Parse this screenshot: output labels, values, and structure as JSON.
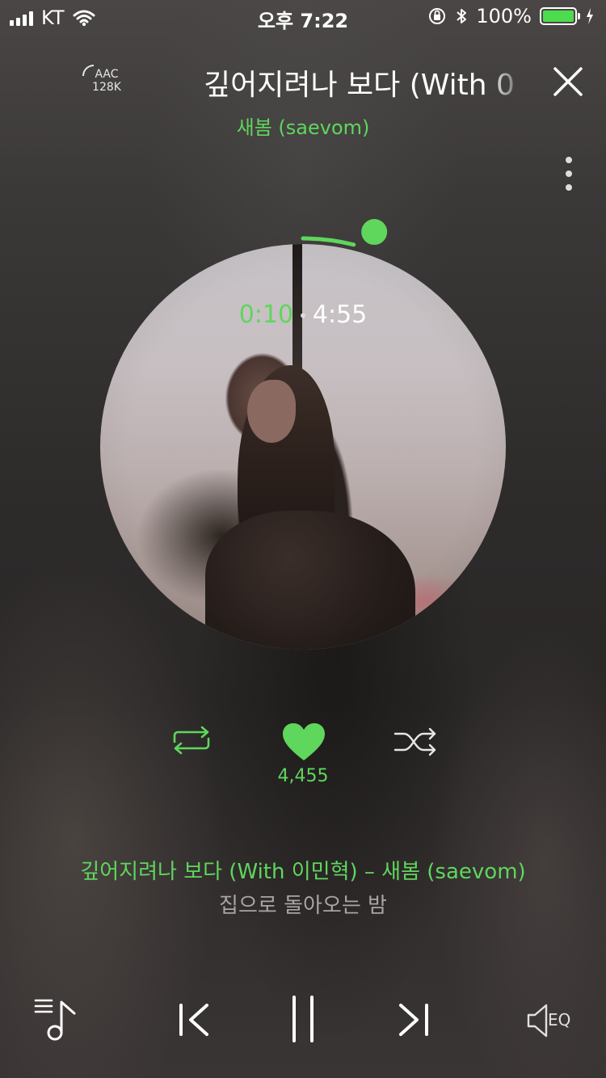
{
  "status_bar": {
    "carrier": "KT",
    "time": "오후 7:22",
    "battery_percent": "100%",
    "battery_level": 1.0,
    "icons": [
      "signal-icon",
      "wifi-icon",
      "orientation-lock-icon",
      "bluetooth-icon",
      "battery-icon",
      "charging-icon"
    ]
  },
  "header": {
    "codec_line1": "AAC",
    "codec_line2": "128K",
    "title": "깊어지려나 보다 (With 0",
    "close_icon": "close-icon",
    "artist": "새봄 (saevom)",
    "more_icon": "more-vertical-icon"
  },
  "player": {
    "current_time": "0:10",
    "separator": "•",
    "total_time": "4:55",
    "progress_fraction": 0.034,
    "accent_color": "#5fd65c"
  },
  "actions": {
    "repeat_icon": "repeat-icon",
    "like_icon": "heart-icon",
    "like_count": "4,455",
    "shuffle_icon": "shuffle-icon"
  },
  "lyrics": {
    "current": "깊어지려나 보다 (With 이민혁) – 새봄 (saevom)",
    "next": "집으로 돌아오는 밤"
  },
  "controls": {
    "playlist_icon": "playlist-icon",
    "prev_icon": "previous-icon",
    "pause_icon": "pause-icon",
    "next_icon": "next-icon",
    "eq_icon": "speaker-icon",
    "eq_label": "EQ"
  }
}
